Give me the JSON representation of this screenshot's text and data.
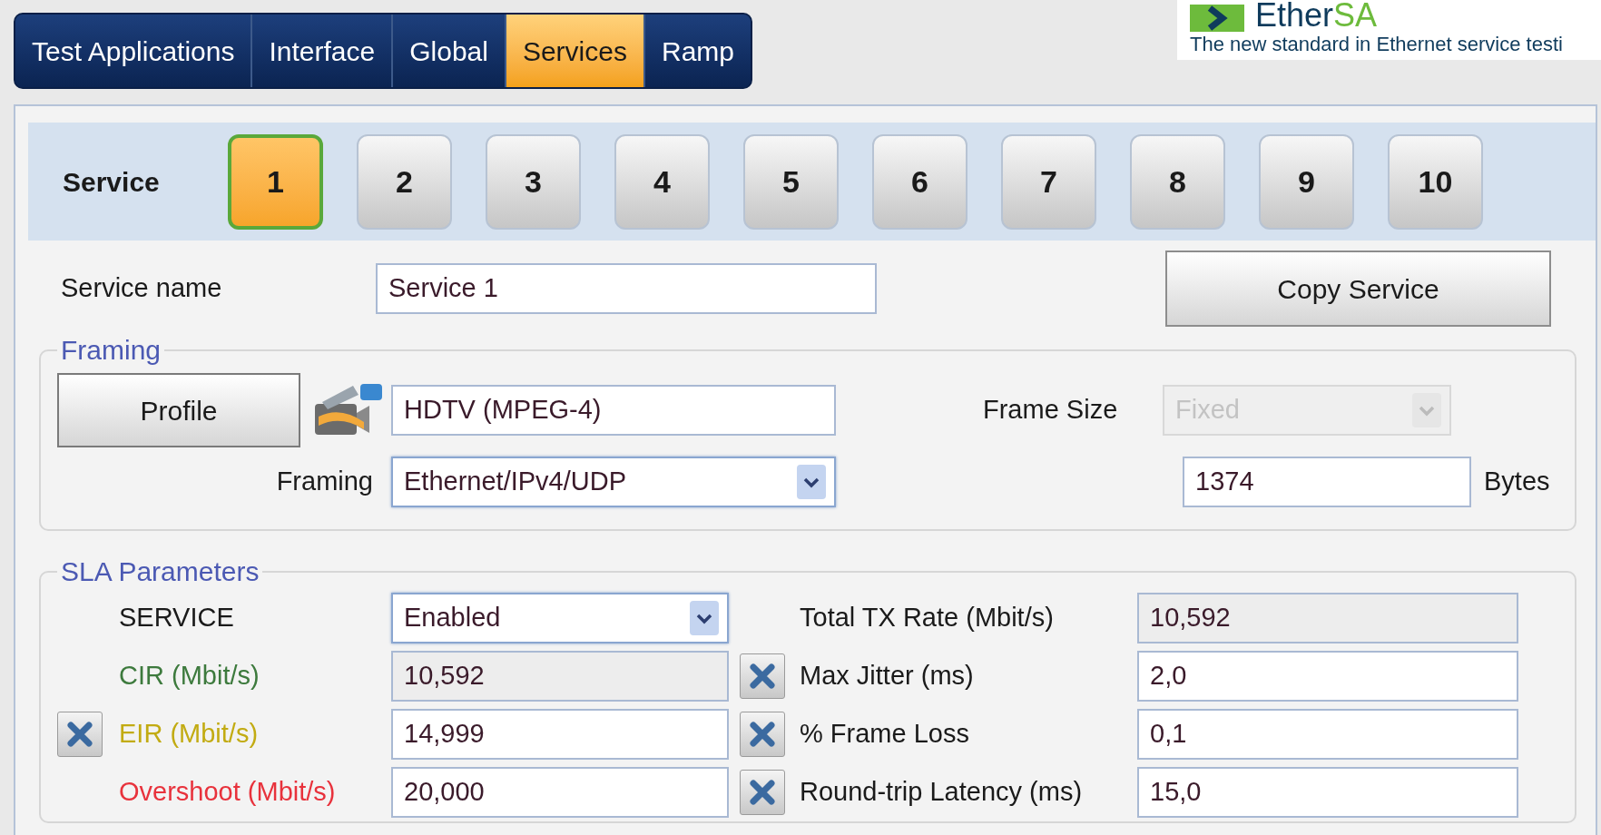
{
  "tabs": [
    {
      "label": "Test Applications",
      "selected": false
    },
    {
      "label": "Interface",
      "selected": false
    },
    {
      "label": "Global",
      "selected": false
    },
    {
      "label": "Services",
      "selected": true
    },
    {
      "label": "Ramp",
      "selected": false
    }
  ],
  "logo": {
    "brand_dark": "Ether",
    "brand_green": "SA",
    "tagline": "The new standard in Ethernet service testi"
  },
  "service_selector": {
    "label": "Service",
    "buttons": [
      {
        "label": "1",
        "selected": true
      },
      {
        "label": "2",
        "selected": false
      },
      {
        "label": "3",
        "selected": false
      },
      {
        "label": "4",
        "selected": false
      },
      {
        "label": "5",
        "selected": false
      },
      {
        "label": "6",
        "selected": false
      },
      {
        "label": "7",
        "selected": false
      },
      {
        "label": "8",
        "selected": false
      },
      {
        "label": "9",
        "selected": false
      },
      {
        "label": "10",
        "selected": false
      }
    ]
  },
  "service_name": {
    "label": "Service name",
    "value": "Service 1"
  },
  "copy_button": "Copy Service",
  "framing": {
    "legend": "Framing",
    "profile_button": "Profile",
    "profile_value": "HDTV (MPEG-4)",
    "framing_label": "Framing",
    "framing_value": "Ethernet/IPv4/UDP",
    "frame_size_label": "Frame Size",
    "frame_size_value": "Fixed",
    "frame_size_disabled": true,
    "size_value": "1374",
    "size_unit": "Bytes"
  },
  "sla": {
    "legend": "SLA Parameters",
    "rows": [
      {
        "left": {
          "label": "SERVICE",
          "color": "#1a1a1a",
          "kind": "select",
          "value": "Enabled",
          "clear_button": false
        },
        "right": {
          "label": "Total TX Rate (Mbit/s)",
          "kind": "readonly",
          "value": "10,592",
          "clear_button": false
        }
      },
      {
        "left": {
          "label": "CIR (Mbit/s)",
          "color": "#3d7a3d",
          "kind": "readonly",
          "value": "10,592",
          "clear_button": false
        },
        "right": {
          "label": "Max Jitter (ms)",
          "kind": "input",
          "value": "2,0",
          "clear_button": true
        }
      },
      {
        "left": {
          "label": "EIR (Mbit/s)",
          "color": "#c2ab12",
          "kind": "input",
          "value": "14,999",
          "clear_button": true
        },
        "right": {
          "label": "% Frame Loss",
          "kind": "input",
          "value": "0,1",
          "clear_button": true
        }
      },
      {
        "left": {
          "label": "Overshoot (Mbit/s)",
          "color": "#e8323c",
          "kind": "input",
          "value": "20,000",
          "clear_button": false
        },
        "right": {
          "label": "Round-trip Latency (ms)",
          "kind": "input",
          "value": "15,0",
          "clear_button": true
        }
      }
    ]
  }
}
